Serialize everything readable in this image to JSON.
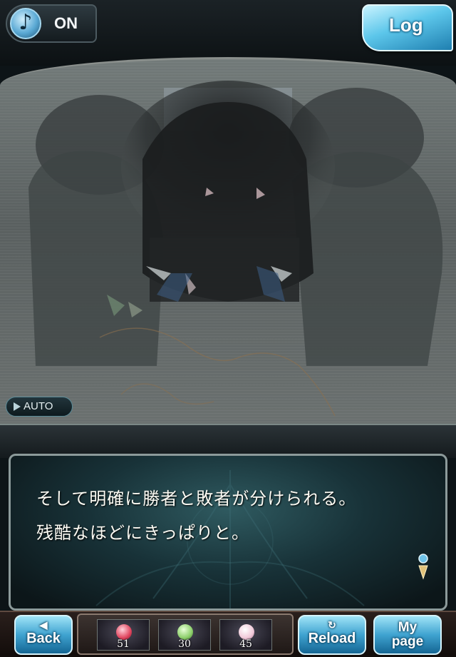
{
  "topbar": {
    "sound_label": "ON",
    "log_label": "Log"
  },
  "scene": {
    "auto_label": "AUTO"
  },
  "message": {
    "text": "そして明確に勝者と敗者が分けられる。\n残酷なほどにきっぱりと。"
  },
  "bottom_bar": {
    "back_label": "Back",
    "reload_label": "Reload",
    "mypage_label": "My\npage",
    "items": [
      {
        "count": "51",
        "color": "#e0455e"
      },
      {
        "count": "30",
        "color": "#8ccf6a"
      },
      {
        "count": "45",
        "color": "#f0c8d8"
      }
    ]
  },
  "colors": {
    "accent": "#5cc6ea",
    "text": "#fbfaf3"
  }
}
